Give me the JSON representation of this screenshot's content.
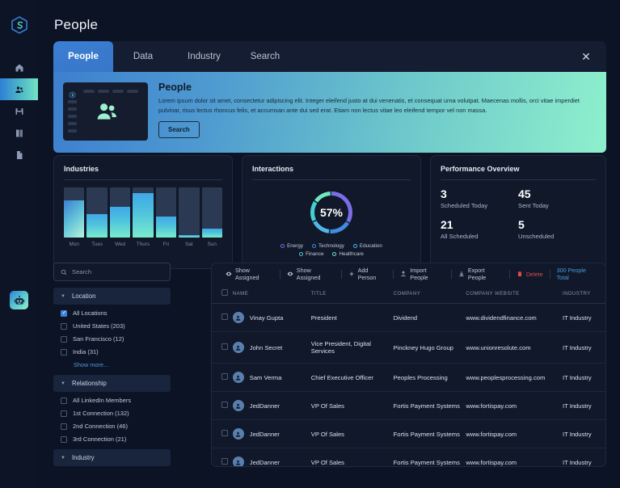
{
  "header": {
    "title": "People"
  },
  "rail": {
    "logo_icon": "hexagon-logo-icon",
    "items": [
      {
        "icon": "home-icon",
        "name": "home",
        "active": false
      },
      {
        "icon": "people-icon",
        "name": "people",
        "active": true
      },
      {
        "icon": "save-icon",
        "name": "saved",
        "active": false
      },
      {
        "icon": "book-icon",
        "name": "library",
        "active": false
      },
      {
        "icon": "document-icon",
        "name": "documents",
        "active": false
      }
    ],
    "bot_icon": "robot-icon"
  },
  "tabs": [
    {
      "label": "People",
      "active": true
    },
    {
      "label": "Data",
      "active": false
    },
    {
      "label": "Industry",
      "active": false
    },
    {
      "label": "Search",
      "active": false
    }
  ],
  "close_label": "✕",
  "hero": {
    "title": "People",
    "description": "Lorem ipsum dolor sit amet, consectetur adipiscing elit. Integer eleifend justo at dui venenatis, et consequat urna volutpat. Maecenas mollis, orci vitae imperdiet pulvinar, risus lectus rhoncus felis, et accumsan ante dui sed erat. Etiam non lectus vitae leo eleifend tempor vel non massa.",
    "button_label": "Search",
    "gradient_start": "#3d7fcf",
    "gradient_end": "#8ef0cc"
  },
  "chart_data": [
    {
      "type": "bar",
      "title": "Industries",
      "categories": [
        "Mon",
        "Tues",
        "Wed",
        "Thurs",
        "Fri",
        "Sat",
        "Sun"
      ],
      "values": [
        74,
        47,
        62,
        88,
        42,
        5,
        18
      ],
      "xlabel": "",
      "ylabel": "",
      "ylim": [
        0,
        100
      ],
      "grid": false,
      "legend": "none"
    },
    {
      "type": "pie",
      "title": "Interactions",
      "center_label": "57%",
      "value": 57,
      "categories": [
        "Energy",
        "Technology",
        "Education",
        "Finance",
        "Healthcare"
      ],
      "values": [
        34,
        18,
        16,
        17,
        15
      ],
      "colors": [
        "#7b6de8",
        "#3d8de0",
        "#4fb6e8",
        "#45d0d0",
        "#6fe8c0"
      ],
      "legend": "bottom"
    }
  ],
  "performance": {
    "title": "Performance Overview",
    "stats": [
      {
        "value": "3",
        "label": "Scheduled Today"
      },
      {
        "value": "45",
        "label": "Sent Today"
      },
      {
        "value": "21",
        "label": "All Scheduled"
      },
      {
        "value": "5",
        "label": "Unscheduled"
      }
    ]
  },
  "filters": {
    "search_placeholder": "Search",
    "groups": [
      {
        "title": "Location",
        "options": [
          {
            "label": "All Locations",
            "checked": true
          },
          {
            "label": "United States (203)",
            "checked": false
          },
          {
            "label": "San Francisco (12)",
            "checked": false
          },
          {
            "label": "India (31)",
            "checked": false
          }
        ],
        "show_more": "Show more..."
      },
      {
        "title": "Relationship",
        "options": [
          {
            "label": "All LinkedIn Members",
            "checked": false
          },
          {
            "label": "1st Connection (132)",
            "checked": false
          },
          {
            "label": "2nd Connection (46)",
            "checked": false
          },
          {
            "label": "3rd Connection (21)",
            "checked": false
          }
        ],
        "show_more": ""
      },
      {
        "title": "Industry",
        "options": [],
        "show_more": ""
      }
    ]
  },
  "toolbar": {
    "buttons": [
      {
        "label": "Show Assigned",
        "icon": "eye-icon",
        "danger": false
      },
      {
        "label": "Show Assigned",
        "icon": "eye-icon",
        "danger": false
      },
      {
        "label": "Add Person",
        "icon": "plus-icon",
        "danger": false
      },
      {
        "label": "Import People",
        "icon": "import-icon",
        "danger": false
      },
      {
        "label": "Export People",
        "icon": "export-icon",
        "danger": false
      },
      {
        "label": "Delete",
        "icon": "trash-icon",
        "danger": true
      }
    ],
    "total_label": "300 People Total",
    "total_color": "#4a9ae0",
    "danger_color": "#e24a4a"
  },
  "table": {
    "columns": [
      "NAME",
      "TITLE",
      "COMPANY",
      "COMPANY WEBSITE",
      "INDUSTRY"
    ],
    "rows": [
      {
        "name": "Vinay Gupta",
        "title": "President",
        "company": "Dividend",
        "website": "www.dividendfinance.com",
        "industry": "IT Industry"
      },
      {
        "name": "John Secret",
        "title": "Vice President, Digital Services",
        "company": "Pinckney Hugo Group",
        "website": "www.unionresolute.com",
        "industry": "IT Industry"
      },
      {
        "name": "Sam Verma",
        "title": "Chief Executive Officer",
        "company": "Peoples Processing",
        "website": "www.peoplesprocessing.com",
        "industry": "IT Industry"
      },
      {
        "name": "JedDanner",
        "title": "VP Of Sales",
        "company": "Fortis Payment Systems",
        "website": "www.fortispay.com",
        "industry": "IT Industry"
      },
      {
        "name": "JedDanner",
        "title": "VP Of Sales",
        "company": "Fortis Payment Systems",
        "website": "www.fortispay.com",
        "industry": "IT Industry"
      },
      {
        "name": "JedDanner",
        "title": "VP Of Sales",
        "company": "Fortis Payment Systems",
        "website": "www.fortispay.com",
        "industry": "IT Industry"
      }
    ]
  }
}
